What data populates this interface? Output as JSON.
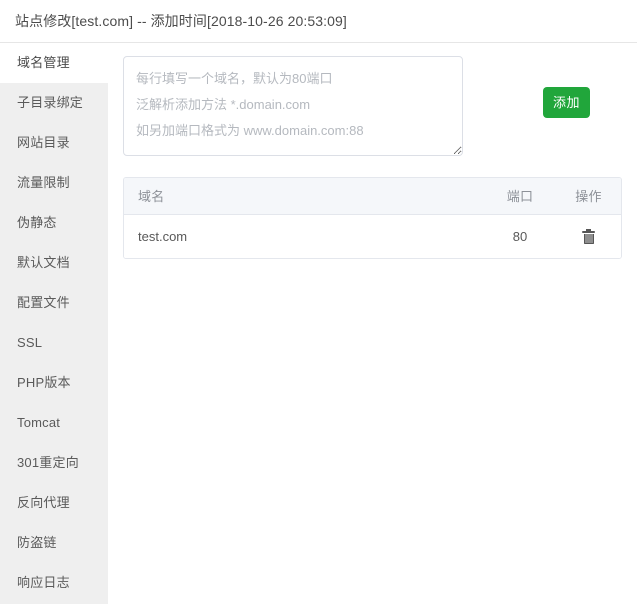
{
  "window": {
    "title": "站点修改[test.com] -- 添加时间[2018-10-26 20:53:09]"
  },
  "sidebar": {
    "items": [
      {
        "label": "域名管理",
        "active": true
      },
      {
        "label": "子目录绑定",
        "active": false
      },
      {
        "label": "网站目录",
        "active": false
      },
      {
        "label": "流量限制",
        "active": false
      },
      {
        "label": "伪静态",
        "active": false
      },
      {
        "label": "默认文档",
        "active": false
      },
      {
        "label": "配置文件",
        "active": false
      },
      {
        "label": "SSL",
        "active": false
      },
      {
        "label": "PHP版本",
        "active": false
      },
      {
        "label": "Tomcat",
        "active": false
      },
      {
        "label": "301重定向",
        "active": false
      },
      {
        "label": "反向代理",
        "active": false
      },
      {
        "label": "防盗链",
        "active": false
      },
      {
        "label": "响应日志",
        "active": false
      }
    ]
  },
  "main": {
    "add_form": {
      "textarea_placeholder": "每行填写一个域名，默认为80端口\n泛解析添加方法 *.domain.com\n如另加端口格式为 www.domain.com:88",
      "textarea_value": "",
      "add_button_label": "添加",
      "add_button_color": "#21a63b"
    },
    "table": {
      "columns": [
        "域名",
        "端口",
        "操作"
      ],
      "rows": [
        {
          "domain": "test.com",
          "port": "80",
          "action_icon": "trash-icon"
        }
      ]
    }
  }
}
